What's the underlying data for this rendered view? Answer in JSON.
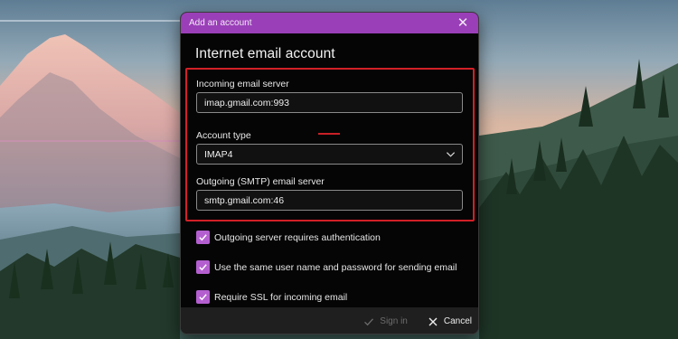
{
  "dialog": {
    "window_title": "Add an account",
    "close_glyph": "✕",
    "heading": "Internet email account"
  },
  "incoming": {
    "label": "Incoming email server",
    "value": "imap.gmail.com:993"
  },
  "account_type": {
    "label": "Account type",
    "selected": "IMAP4"
  },
  "outgoing": {
    "label": "Outgoing (SMTP) email server",
    "value": "smtp.gmail.com:46"
  },
  "options": [
    {
      "label": "Outgoing server requires authentication",
      "checked": true
    },
    {
      "label": "Use the same user name and password for sending email",
      "checked": true
    },
    {
      "label": "Require SSL for incoming email",
      "checked": true
    }
  ],
  "footer": {
    "signin_label": "Sign in",
    "cancel_label": "Cancel"
  },
  "colors": {
    "titlebar": "#9a3fb8",
    "checkbox": "#b45fd0",
    "highlight_border": "#d32027"
  },
  "icons": {
    "close": "close-icon",
    "dropdown": "chevron-down-icon",
    "check": "checkmark-icon",
    "signin": "checkmark-icon",
    "cancel": "x-icon"
  }
}
